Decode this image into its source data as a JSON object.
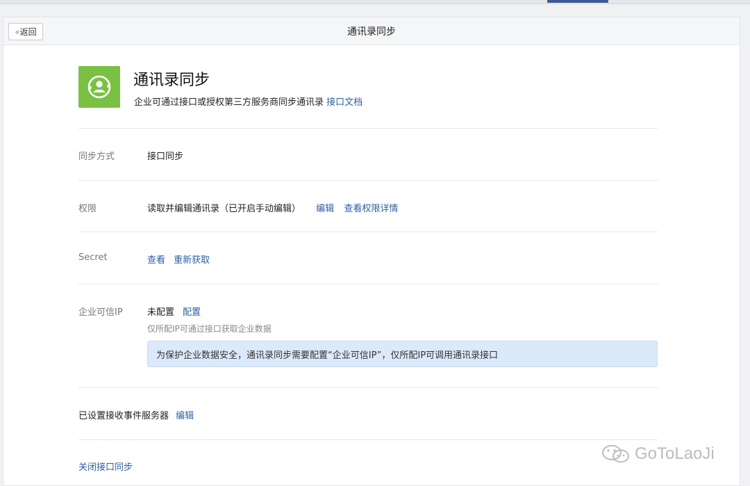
{
  "header": {
    "back_label": "返回",
    "title": "通讯录同步"
  },
  "hero": {
    "icon": "contact-sync-icon",
    "icon_color": "#7ac143",
    "title": "通讯录同步",
    "description": "企业可通过接口或授权第三方服务商同步通讯录",
    "doc_link": "接口文档"
  },
  "settings": {
    "sync_method": {
      "label": "同步方式",
      "value": "接口同步"
    },
    "permission": {
      "label": "权限",
      "value": "读取并编辑通讯录（已开启手动编辑）",
      "edit": "编辑",
      "details": "查看权限详情"
    },
    "secret": {
      "label": "Secret",
      "view": "查看",
      "refresh": "重新获取"
    },
    "trusted_ip": {
      "label": "企业可信IP",
      "status": "未配置",
      "configure": "配置",
      "note": "仅所配IP可通过接口获取企业数据",
      "alert": "为保护企业数据安全，通讯录同步需要配置“企业可信IP”，仅所配IP可调用通讯录接口"
    },
    "event_server": {
      "text": "已设置接收事件服务器",
      "edit": "编辑"
    },
    "close_sync": "关闭接口同步"
  },
  "watermark": {
    "text": "GoToLaoJi",
    "icon": "wechat-icon"
  },
  "colors": {
    "link": "#2d5fa3",
    "alert_bg": "#dbe9fa",
    "accent": "#3c5b94"
  }
}
